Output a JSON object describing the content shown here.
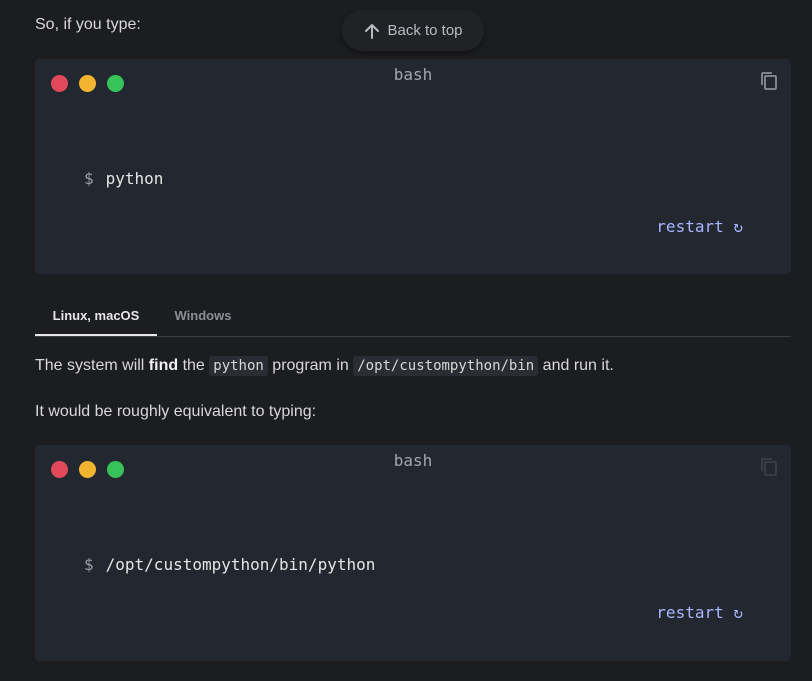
{
  "intro": {
    "text": "So, if you type:"
  },
  "back_to_top": {
    "label": "Back to top"
  },
  "terminal_1": {
    "title": "bash",
    "prompt": "$",
    "command": "python",
    "restart_label": "restart ↻"
  },
  "tabs": [
    {
      "label": "Linux, macOS",
      "active": true
    },
    {
      "label": "Windows",
      "active": false
    }
  ],
  "paragraph_1": {
    "part1": "The system will ",
    "bold": "find",
    "part2": " the ",
    "code1": "python",
    "part3": " program in ",
    "code2": "/opt/custompython/bin",
    "part4": " and run it."
  },
  "paragraph_2": {
    "text": "It would be roughly equivalent to typing:"
  },
  "terminal_2": {
    "title": "bash",
    "prompt": "$",
    "command": "/opt/custompython/bin/python",
    "restart_label": "restart ↻"
  },
  "colors": {
    "background": "#1c1d20",
    "terminal_bg": "#23272f",
    "dot_red": "#e0495a",
    "dot_yellow": "#f2b431",
    "dot_green": "#38c25a",
    "restart_link": "#a8b6ff"
  },
  "icons": [
    "arrow-up-icon",
    "copy-icon",
    "window-dot-red",
    "window-dot-yellow",
    "window-dot-green"
  ]
}
